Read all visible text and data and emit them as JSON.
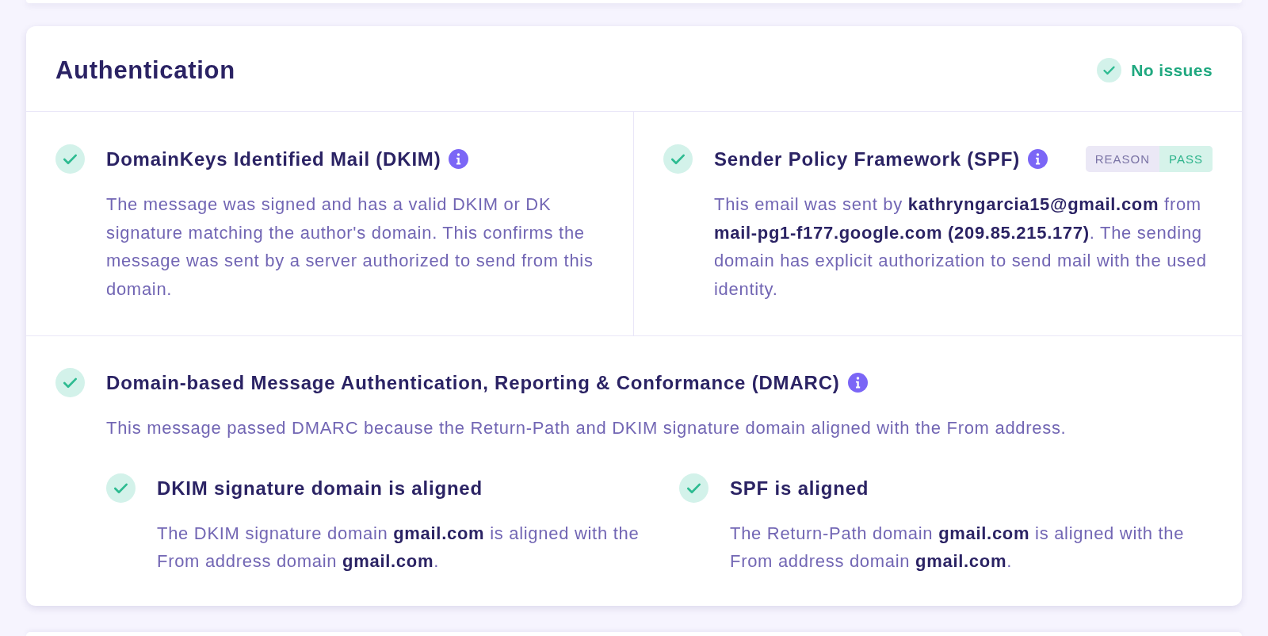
{
  "header": {
    "title": "Authentication",
    "status": {
      "passed": true,
      "label": "No issues"
    }
  },
  "checks": [
    {
      "title": "DomainKeys Identified Mail (DKIM)",
      "passed": true,
      "info": true,
      "description": "The message was signed and has a valid DKIM or DK signature matching the author's domain. This confirms the message was sent by a server authorized to send from this domain."
    },
    {
      "title": "Sender Policy Framework (SPF)",
      "passed": true,
      "info": true,
      "badge": {
        "label": "REASON",
        "value": "PASS"
      },
      "description": "This email was sent by **kathryngarcia15@gmail.com** from **mail-pg1-f177.google.com (209.85.215.177)**. The sending domain has explicit authorization to send mail with the used identity."
    }
  ],
  "dmarc": {
    "title": "Domain-based Message Authentication, Reporting & Conformance (DMARC)",
    "passed": true,
    "info": true,
    "description": "This message passed DMARC because the Return-Path and DKIM signature domain aligned with the From address.",
    "alignments": [
      {
        "title": "DKIM signature domain is aligned",
        "passed": true,
        "description": "The DKIM signature domain **gmail.com** is aligned with the From address domain **gmail.com**."
      },
      {
        "title": "SPF is aligned",
        "passed": true,
        "description": "The Return-Path domain **gmail.com** is aligned with the From address domain **gmail.com**."
      }
    ]
  }
}
